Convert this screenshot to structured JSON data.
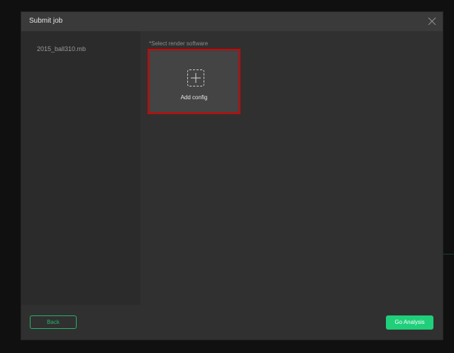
{
  "dialog": {
    "title": "Submit job",
    "close_icon": "close-icon"
  },
  "file_list": {
    "items": [
      {
        "label": "2015_ball310.mb"
      }
    ]
  },
  "main": {
    "hint": "*Select render software",
    "add_config": {
      "icon": "plus-icon",
      "label": "Add config"
    }
  },
  "footer": {
    "back_label": "Back",
    "go_label": "Go Analysis"
  },
  "colors": {
    "accent": "#1fcf7a",
    "highlight_border": "#d40000"
  }
}
